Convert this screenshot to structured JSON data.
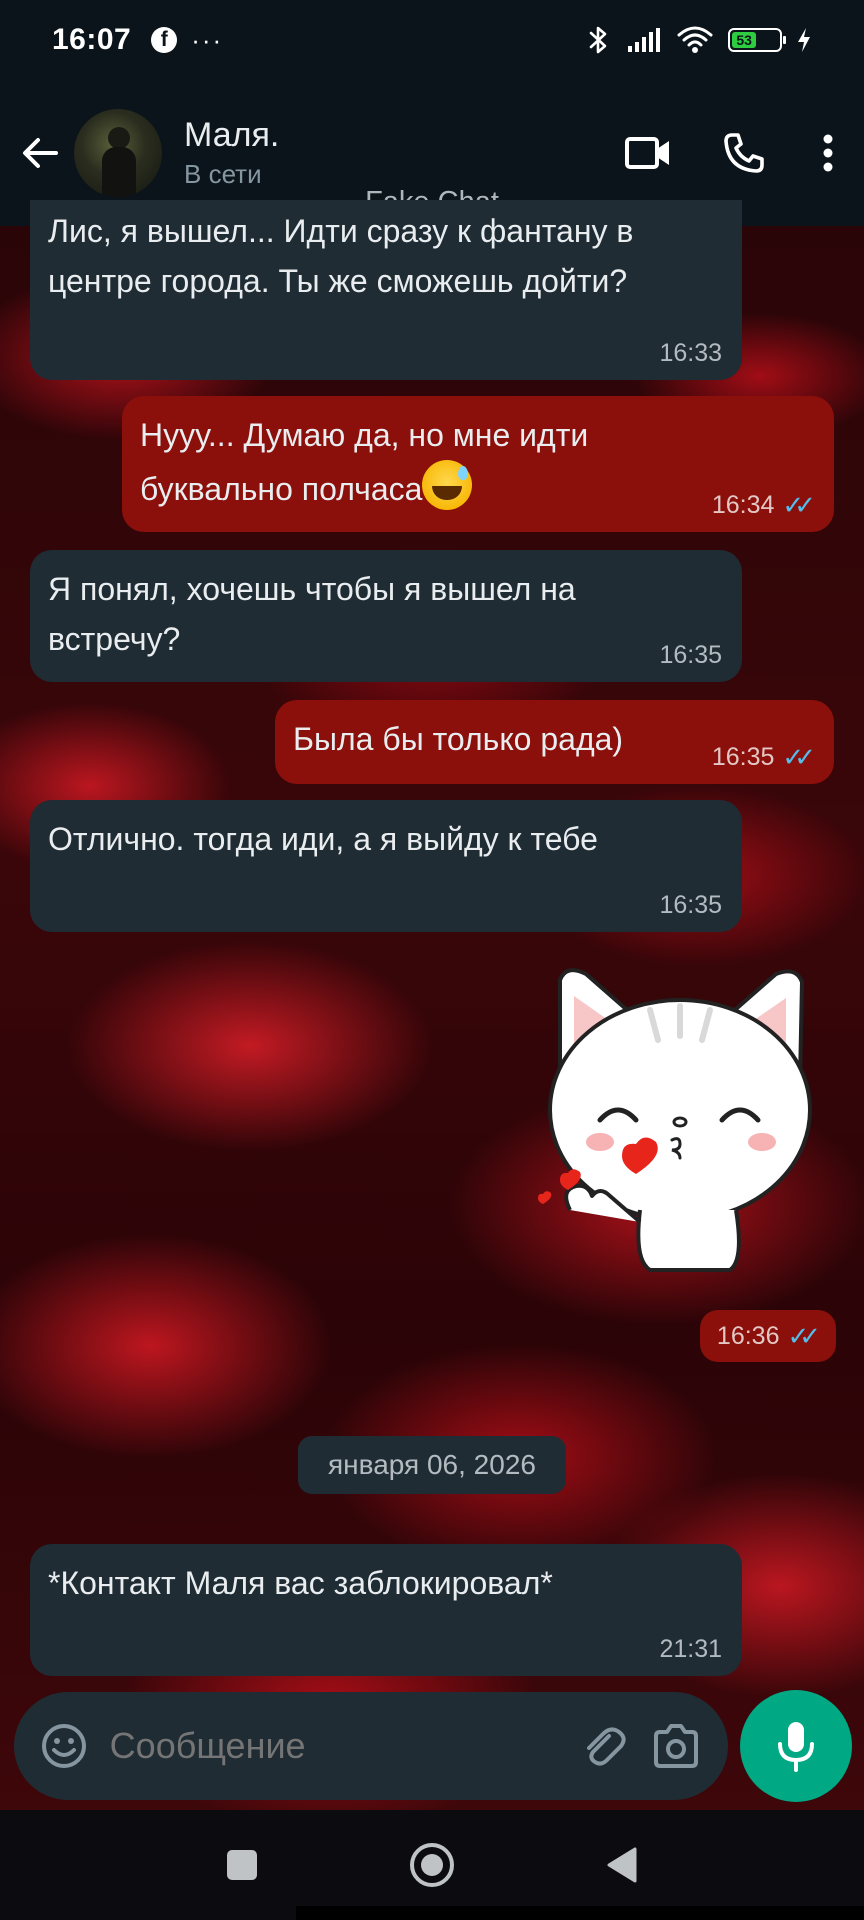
{
  "status_bar": {
    "time": "16:07",
    "fb_glyph": "f",
    "dots": "···",
    "battery_level": "53",
    "icons": [
      "bluetooth-icon",
      "signal-icon",
      "wifi-icon",
      "battery-icon",
      "charging-icon"
    ]
  },
  "header": {
    "contact_name": "Маля.",
    "contact_status": "В сети",
    "watermark": "Fake Chat",
    "icons": [
      "back-arrow-icon",
      "video-call-icon",
      "phone-icon",
      "more-vertical-icon"
    ]
  },
  "messages": [
    {
      "direction": "in",
      "lines": [
        "Лис, я вышел... Идти сразу к фантану в",
        "центре города. Ты же сможешь дойти?"
      ],
      "time": "16:33"
    },
    {
      "direction": "out",
      "lines": [
        "Нууу... Думаю да, но мне идти",
        "буквально полчаса"
      ],
      "emoji": "grinning-sweat-emoji",
      "time": "16:34",
      "status": "read"
    },
    {
      "direction": "in",
      "lines": [
        "Я понял, хочешь чтобы я вышел на",
        "встречу?"
      ],
      "time": "16:35"
    },
    {
      "direction": "out",
      "lines": [
        "Была бы только рада)"
      ],
      "time": "16:35",
      "status": "read"
    },
    {
      "direction": "in",
      "lines": [
        "Отлично. тогда иди, а я выйду к тебе"
      ],
      "time": "16:35"
    },
    {
      "direction": "out",
      "type": "sticker",
      "sticker": "kissing-cat-sticker",
      "time": "16:36",
      "status": "read"
    },
    {
      "direction": "in",
      "lines": [
        "*Контакт Маля вас заблокировал*"
      ],
      "time": "21:31"
    }
  ],
  "date_chip": "января 06, 2026",
  "input_bar": {
    "placeholder": "Сообщение",
    "icons": [
      "emoji-icon",
      "attach-icon",
      "camera-icon",
      "mic-icon"
    ]
  },
  "colors": {
    "header_bg": "#0b141a",
    "incoming_bubble": "#1f2c34",
    "outgoing_bubble": "#8b0f0a",
    "read_tick": "#53bdeb",
    "mic_button": "#00a884"
  }
}
